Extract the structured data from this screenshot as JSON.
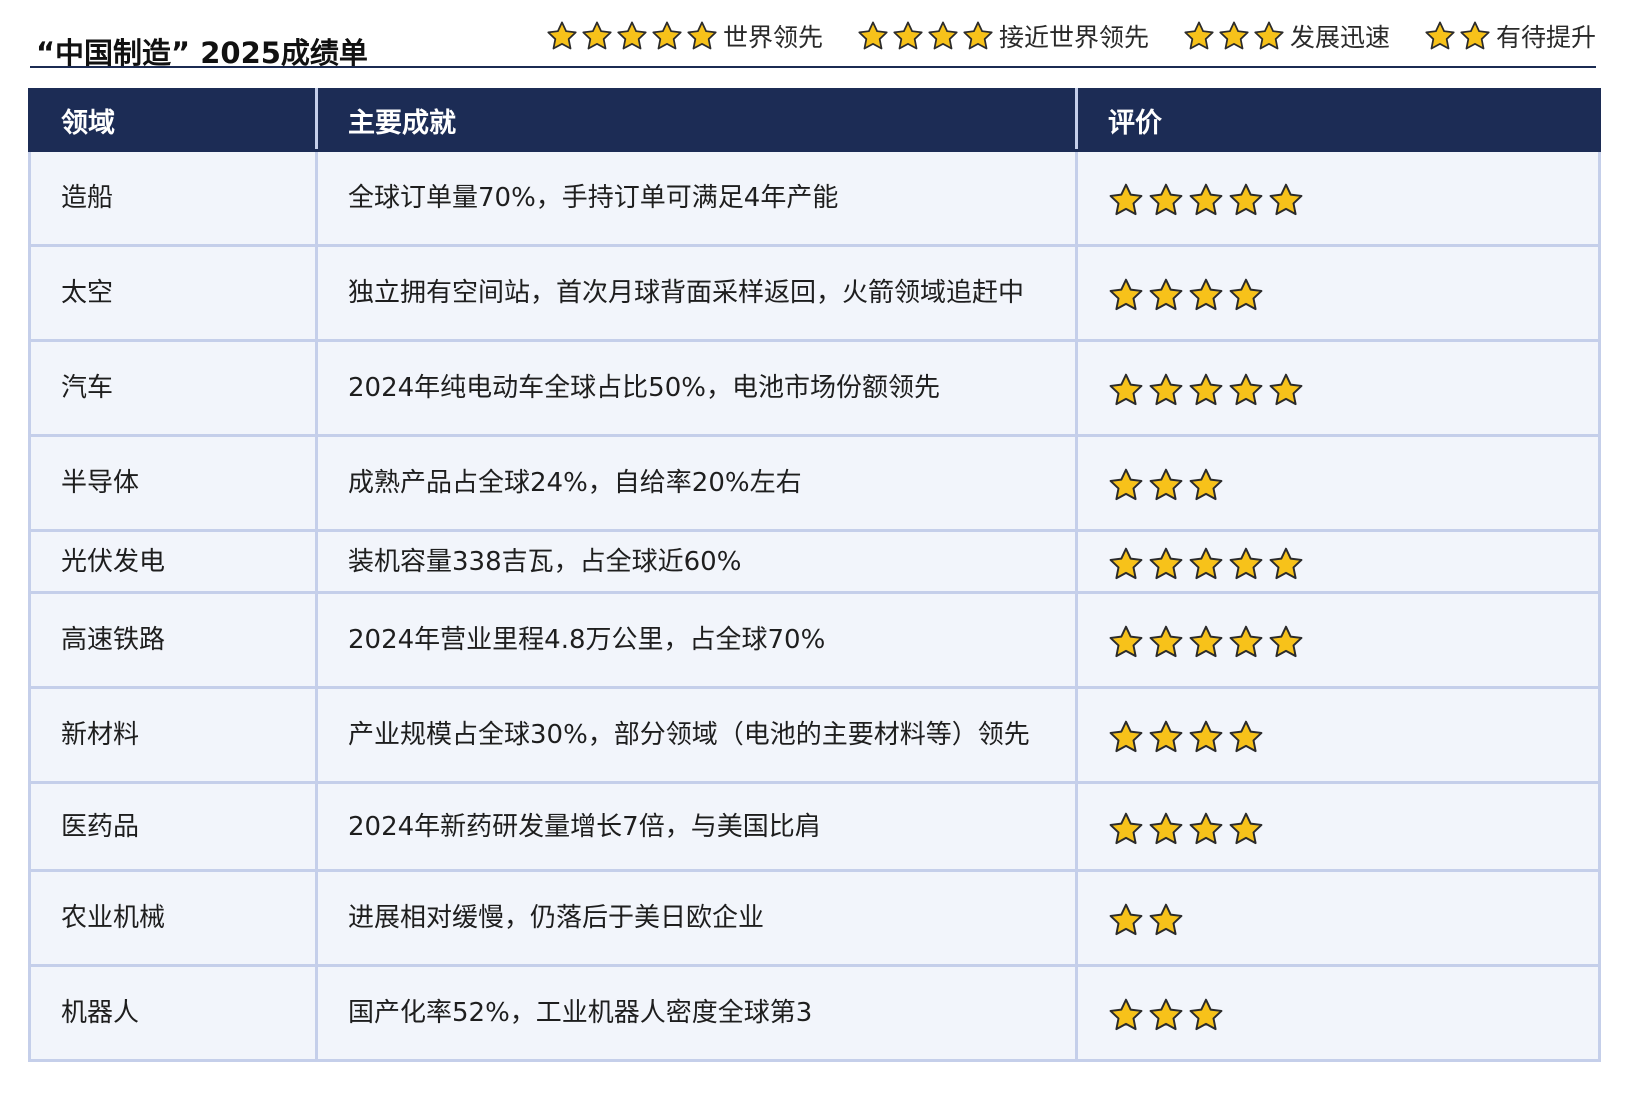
{
  "title": "“中国制造” 2025成绩单",
  "legend": [
    {
      "stars": 5,
      "label": "世界领先"
    },
    {
      "stars": 4,
      "label": "接近世界领先"
    },
    {
      "stars": 3,
      "label": "发展迅速"
    },
    {
      "stars": 2,
      "label": "有待提升"
    }
  ],
  "table": {
    "headers": [
      "领域",
      "主要成就",
      "评价"
    ],
    "rows": [
      {
        "field": "造船",
        "achievement": "全球订单量70%，手持订单可满足4年产能",
        "stars": 5
      },
      {
        "field": "太空",
        "achievement": "独立拥有空间站，首次月球背面采样返回，火箭领域追赶中",
        "stars": 4
      },
      {
        "field": "汽车",
        "achievement": "2024年纯电动车全球占比50%，电池市场份额领先",
        "stars": 5
      },
      {
        "field": "半导体",
        "achievement": "成熟产品占全球24%，自给率20%左右",
        "stars": 3
      },
      {
        "field": "光伏发电",
        "achievement": "装机容量338吉瓦，占全球近60%",
        "stars": 5
      },
      {
        "field": "高速铁路",
        "achievement": "2024年营业里程4.8万公里，占全球70%",
        "stars": 5
      },
      {
        "field": "新材料",
        "achievement": "产业规模占全球30%，部分领域（电池的主要材料等）领先",
        "stars": 4
      },
      {
        "field": "医药品",
        "achievement": "2024年新药研发量增长7倍，与美国比肩",
        "stars": 4
      },
      {
        "field": "农业机械",
        "achievement": "进展相对缓慢，仍落后于美日欧企业",
        "stars": 2
      },
      {
        "field": "机器人",
        "achievement": "国产化率52%，工业机器人密度全球第3",
        "stars": 3
      }
    ]
  },
  "colors": {
    "header_bg": "#1c2c55",
    "cell_bg": "#f2f5fb",
    "border": "#c5cfea",
    "star_fill": "#f7c21a",
    "star_stroke": "#2b2b2b"
  },
  "icons": {
    "rating": "star-icon"
  }
}
